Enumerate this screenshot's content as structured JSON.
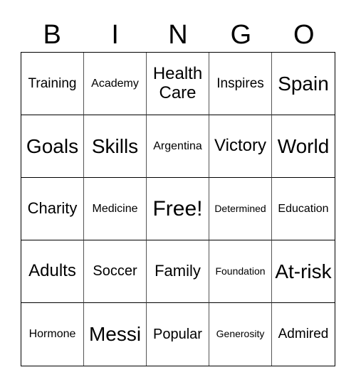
{
  "header": [
    "B",
    "I",
    "N",
    "G",
    "O"
  ],
  "cells": [
    {
      "text": "Training",
      "size": "s19"
    },
    {
      "text": "Academy",
      "size": "s16"
    },
    {
      "text": "Health Care",
      "size": "s24"
    },
    {
      "text": "Inspires",
      "size": "s19"
    },
    {
      "text": "Spain",
      "size": "s28"
    },
    {
      "text": "Goals",
      "size": "s28"
    },
    {
      "text": "Skills",
      "size": "s28"
    },
    {
      "text": "Argentina",
      "size": "s16"
    },
    {
      "text": "Victory",
      "size": "s24"
    },
    {
      "text": "World",
      "size": "s28"
    },
    {
      "text": "Charity",
      "size": "s22"
    },
    {
      "text": "Medicine",
      "size": "s16"
    },
    {
      "text": "Free!",
      "size": "s30"
    },
    {
      "text": "Determined",
      "size": "s14"
    },
    {
      "text": "Education",
      "size": "s16"
    },
    {
      "text": "Adults",
      "size": "s24"
    },
    {
      "text": "Soccer",
      "size": "s20"
    },
    {
      "text": "Family",
      "size": "s22"
    },
    {
      "text": "Foundation",
      "size": "s14"
    },
    {
      "text": "At-risk",
      "size": "s28"
    },
    {
      "text": "Hormone",
      "size": "s16"
    },
    {
      "text": "Messi",
      "size": "s28"
    },
    {
      "text": "Popular",
      "size": "s20"
    },
    {
      "text": "Generosity",
      "size": "s14"
    },
    {
      "text": "Admired",
      "size": "s19"
    }
  ]
}
